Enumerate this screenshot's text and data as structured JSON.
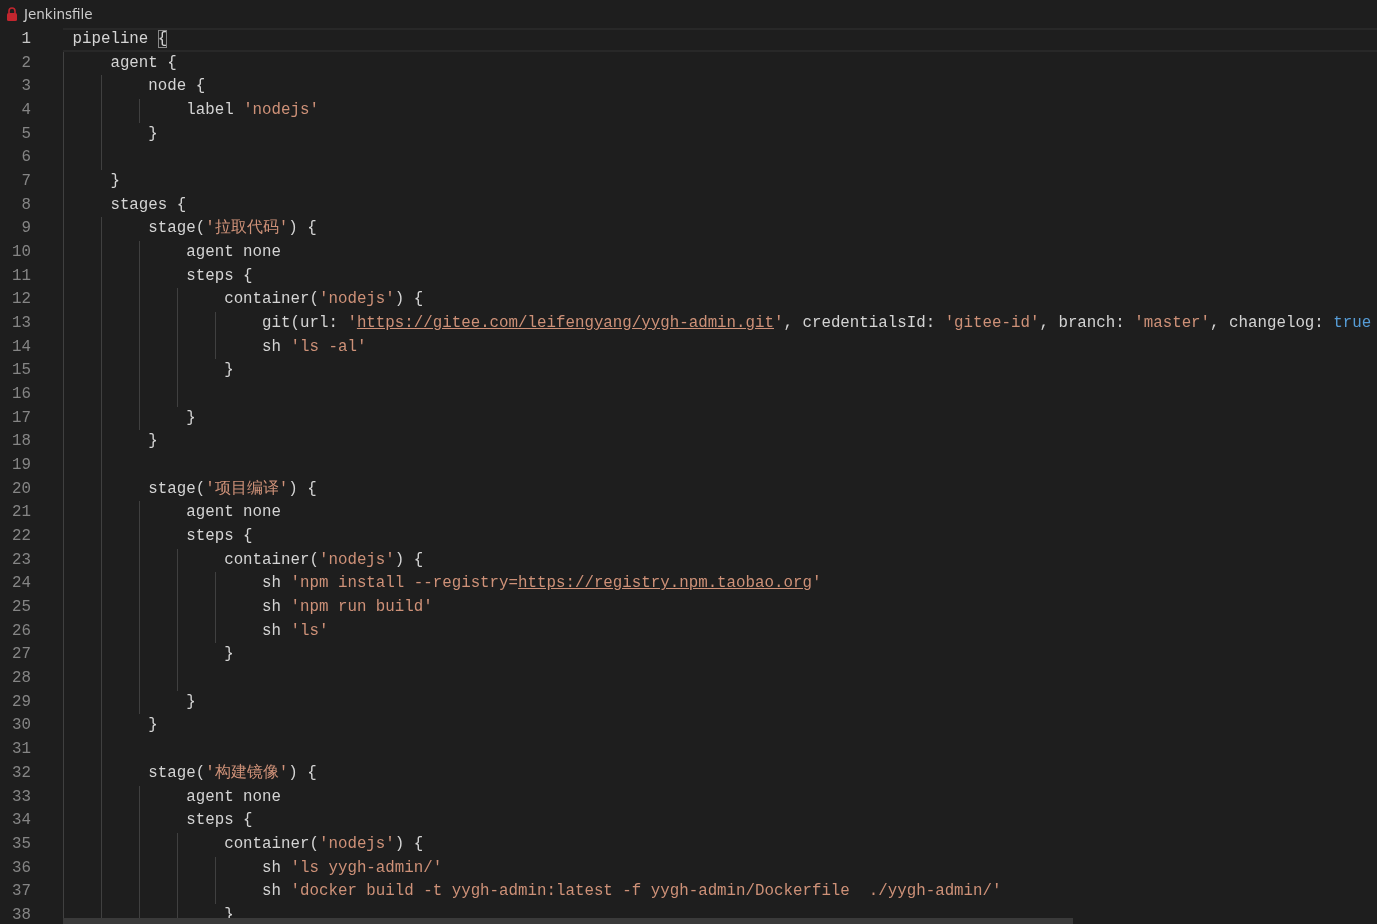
{
  "tab": {
    "title": "Jenkinsfile"
  },
  "lines": [
    {
      "number": "1",
      "current": true,
      "tokens": [
        {
          "kind": "plain",
          "text": "pipeline "
        },
        {
          "kind": "bracket",
          "text": "{"
        }
      ]
    },
    {
      "number": "2",
      "current": false,
      "tokens": [
        {
          "kind": "plain",
          "text": "    agent {"
        }
      ]
    },
    {
      "number": "3",
      "current": false,
      "tokens": [
        {
          "kind": "plain",
          "text": "        node {"
        }
      ]
    },
    {
      "number": "4",
      "current": false,
      "tokens": [
        {
          "kind": "plain",
          "text": "            label "
        },
        {
          "kind": "string",
          "text": "'nodejs'"
        }
      ]
    },
    {
      "number": "5",
      "current": false,
      "tokens": [
        {
          "kind": "plain",
          "text": "        }"
        }
      ]
    },
    {
      "number": "6",
      "current": false
    },
    {
      "number": "7",
      "current": false,
      "tokens": [
        {
          "kind": "plain",
          "text": "    }"
        }
      ]
    },
    {
      "number": "8",
      "current": false,
      "tokens": [
        {
          "kind": "plain",
          "text": "    stages {"
        }
      ]
    },
    {
      "number": "9",
      "current": false,
      "tokens": [
        {
          "kind": "plain",
          "text": "        stage("
        },
        {
          "kind": "string",
          "text": "'拉取代码'"
        },
        {
          "kind": "plain",
          "text": ") {"
        }
      ]
    },
    {
      "number": "10",
      "current": false,
      "tokens": [
        {
          "kind": "plain",
          "text": "            agent none"
        }
      ]
    },
    {
      "number": "11",
      "current": false,
      "tokens": [
        {
          "kind": "plain",
          "text": "            steps {"
        }
      ]
    },
    {
      "number": "12",
      "current": false,
      "tokens": [
        {
          "kind": "plain",
          "text": "                container("
        },
        {
          "kind": "string",
          "text": "'nodejs'"
        },
        {
          "kind": "plain",
          "text": ") {"
        }
      ]
    },
    {
      "number": "13",
      "current": false,
      "tokens": [
        {
          "kind": "plain",
          "text": "                    git(url: "
        },
        {
          "kind": "string",
          "text": "'"
        },
        {
          "kind": "link",
          "text": "https://gitee.com/leifengyang/yygh-admin.git"
        },
        {
          "kind": "string",
          "text": "'"
        },
        {
          "kind": "plain",
          "text": ", credentialsId: "
        },
        {
          "kind": "string",
          "text": "'gitee-id'"
        },
        {
          "kind": "plain",
          "text": ", branch: "
        },
        {
          "kind": "string",
          "text": "'master'"
        },
        {
          "kind": "plain",
          "text": ", changelog: "
        },
        {
          "kind": "keyword",
          "text": "true"
        }
      ]
    },
    {
      "number": "14",
      "current": false,
      "tokens": [
        {
          "kind": "plain",
          "text": "                    sh "
        },
        {
          "kind": "string",
          "text": "'ls -al'"
        }
      ]
    },
    {
      "number": "15",
      "current": false,
      "tokens": [
        {
          "kind": "plain",
          "text": "                }"
        }
      ]
    },
    {
      "number": "16",
      "current": false
    },
    {
      "number": "17",
      "current": false,
      "tokens": [
        {
          "kind": "plain",
          "text": "            }"
        }
      ]
    },
    {
      "number": "18",
      "current": false,
      "tokens": [
        {
          "kind": "plain",
          "text": "        }"
        }
      ]
    },
    {
      "number": "19",
      "current": false
    },
    {
      "number": "20",
      "current": false,
      "tokens": [
        {
          "kind": "plain",
          "text": "        stage("
        },
        {
          "kind": "string",
          "text": "'项目编译'"
        },
        {
          "kind": "plain",
          "text": ") {"
        }
      ]
    },
    {
      "number": "21",
      "current": false,
      "tokens": [
        {
          "kind": "plain",
          "text": "            agent none"
        }
      ]
    },
    {
      "number": "22",
      "current": false,
      "tokens": [
        {
          "kind": "plain",
          "text": "            steps {"
        }
      ]
    },
    {
      "number": "23",
      "current": false,
      "tokens": [
        {
          "kind": "plain",
          "text": "                container("
        },
        {
          "kind": "string",
          "text": "'nodejs'"
        },
        {
          "kind": "plain",
          "text": ") {"
        }
      ]
    },
    {
      "number": "24",
      "current": false,
      "tokens": [
        {
          "kind": "plain",
          "text": "                    sh "
        },
        {
          "kind": "string",
          "text": "'npm install --registry="
        },
        {
          "kind": "link",
          "text": "https://registry.npm.taobao.org"
        },
        {
          "kind": "string",
          "text": "'"
        }
      ]
    },
    {
      "number": "25",
      "current": false,
      "tokens": [
        {
          "kind": "plain",
          "text": "                    sh "
        },
        {
          "kind": "string",
          "text": "'npm run build'"
        }
      ]
    },
    {
      "number": "26",
      "current": false,
      "tokens": [
        {
          "kind": "plain",
          "text": "                    sh "
        },
        {
          "kind": "string",
          "text": "'ls'"
        }
      ]
    },
    {
      "number": "27",
      "current": false,
      "tokens": [
        {
          "kind": "plain",
          "text": "                }"
        }
      ]
    },
    {
      "number": "28",
      "current": false
    },
    {
      "number": "29",
      "current": false,
      "tokens": [
        {
          "kind": "plain",
          "text": "            }"
        }
      ]
    },
    {
      "number": "30",
      "current": false,
      "tokens": [
        {
          "kind": "plain",
          "text": "        }"
        }
      ]
    },
    {
      "number": "31",
      "current": false
    },
    {
      "number": "32",
      "current": false,
      "tokens": [
        {
          "kind": "plain",
          "text": "        stage("
        },
        {
          "kind": "string",
          "text": "'构建镜像'"
        },
        {
          "kind": "plain",
          "text": ") {"
        }
      ]
    },
    {
      "number": "33",
      "current": false,
      "tokens": [
        {
          "kind": "plain",
          "text": "            agent none"
        }
      ]
    },
    {
      "number": "34",
      "current": false,
      "tokens": [
        {
          "kind": "plain",
          "text": "            steps {"
        }
      ]
    },
    {
      "number": "35",
      "current": false,
      "tokens": [
        {
          "kind": "plain",
          "text": "                container("
        },
        {
          "kind": "string",
          "text": "'nodejs'"
        },
        {
          "kind": "plain",
          "text": ") {"
        }
      ]
    },
    {
      "number": "36",
      "current": false,
      "tokens": [
        {
          "kind": "plain",
          "text": "                    sh "
        },
        {
          "kind": "string",
          "text": "'ls yygh-admin/'"
        }
      ]
    },
    {
      "number": "37",
      "current": false,
      "tokens": [
        {
          "kind": "plain",
          "text": "                    sh "
        },
        {
          "kind": "string",
          "text": "'docker build -t yygh-admin:latest -f yygh-admin/Dockerfile  ./yygh-admin/'"
        }
      ]
    },
    {
      "number": "38",
      "current": false,
      "tokens": [
        {
          "kind": "plain",
          "text": "                }"
        }
      ]
    }
  ]
}
